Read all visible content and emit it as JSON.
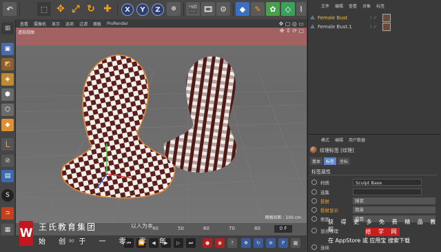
{
  "toolbar": {
    "axes": [
      "X",
      "Y",
      "Z"
    ]
  },
  "viewport_menu": [
    "查看",
    "摄像机",
    "显示",
    "选项",
    "过滤",
    "面板",
    "ProRender"
  ],
  "viewport": {
    "label": "透视视图",
    "grid_info": "网格间距 : 100 cm"
  },
  "timeline": {
    "ticks": [
      "40",
      "50",
      "60",
      "70",
      "80",
      "90"
    ],
    "frame": "0 F"
  },
  "brand": {
    "logo": "W",
    "name": "王氏教育集团",
    "slogan": "以人为本",
    "tagline": "始 创 于 一 零 零 年",
    "sub": "90"
  },
  "object_manager": {
    "menu": [
      "文件",
      "编辑",
      "查看",
      "对象",
      "标签"
    ],
    "objects": [
      {
        "name": "Female Bust",
        "selected": true
      },
      {
        "name": "Female Bust.1",
        "selected": false
      }
    ]
  },
  "attribute_manager": {
    "menu": [
      "模式",
      "编辑",
      "用户数据"
    ],
    "header": "纹理标签 [纹理]",
    "tabs": [
      "基本",
      "标签",
      "坐标"
    ],
    "active_tab": "标签",
    "section": "标签属性",
    "params": [
      {
        "label": "材质",
        "value": "Sculpt Base",
        "type": "field",
        "orange": false
      },
      {
        "label": "选集",
        "value": "",
        "type": "field",
        "orange": false
      },
      {
        "label": "投射",
        "value": "球状",
        "type": "dropdown",
        "orange": true
      },
      {
        "label": "投射显示",
        "value": "简单",
        "type": "dropdown",
        "orange": true
      },
      {
        "label": "侧面",
        "value": "双面",
        "type": "dropdown",
        "orange": false
      },
      {
        "label": "混合纹理",
        "value": "",
        "type": "field",
        "orange": false
      },
      {
        "label": "连续",
        "value": "",
        "type": "field",
        "orange": false
      }
    ]
  },
  "promo": {
    "line1": "获 得 更 多 免 费 精 品 教 程",
    "line2": "给 学 网",
    "line3": "在 AppStore 或 应用宝 搜索下载"
  }
}
